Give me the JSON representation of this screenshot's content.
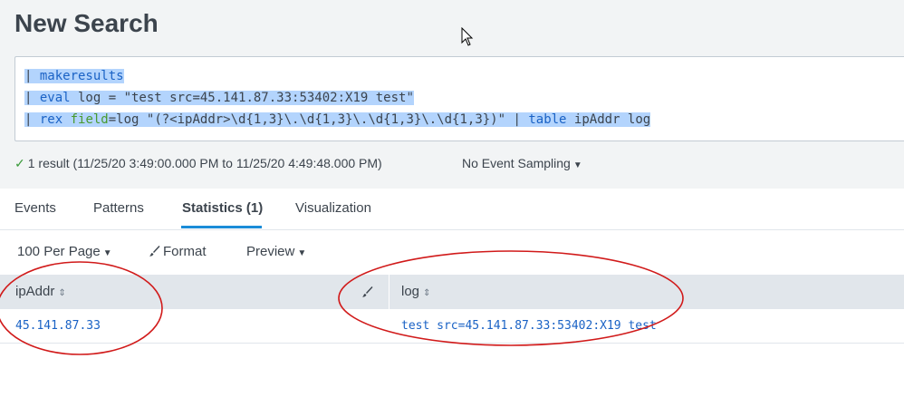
{
  "page": {
    "title": "New Search"
  },
  "query": {
    "line1": {
      "pipe": "| ",
      "cmd": "makeresults"
    },
    "line2": {
      "pipe": "| ",
      "cmd": "eval",
      "rest": " log = \"test src=45.141.87.33:53402:X19 test\""
    },
    "line3": {
      "pipe": "| ",
      "cmd": "rex",
      "sp": " ",
      "arg": "field",
      "rest": "=log \"(?<ipAddr>\\d{1,3}\\.\\d{1,3}\\.\\d{1,3}\\.\\d{1,3})\" | ",
      "cmd2": "table",
      "rest2": " ipAddr log"
    }
  },
  "status": {
    "result_text": "1 result (11/25/20 3:49:00.000 PM to 11/25/20 4:49:48.000 PM)",
    "sampling": "No Event Sampling"
  },
  "tabs": [
    "Events",
    "Patterns",
    "Statistics (1)",
    "Visualization"
  ],
  "active_tab": "Statistics (1)",
  "toolbar": {
    "per_page": "100 Per Page",
    "format": "Format",
    "preview": "Preview"
  },
  "table": {
    "columns": [
      "ipAddr",
      "log"
    ],
    "rows": [
      {
        "ipAddr": "45.141.87.33",
        "log": "test src=45.141.87.33:53402:X19 test"
      }
    ]
  },
  "colors": {
    "accent": "#1a8cd8",
    "highlight": "#b3d4fd",
    "command": "#1a62c5",
    "argument": "#4a9a2e",
    "annotation": "#d11a1a"
  }
}
